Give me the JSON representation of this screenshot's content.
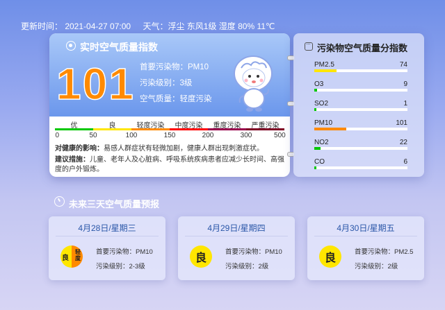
{
  "topbar": {
    "update": "更新时间：  2021-04-27 07:00",
    "weather": "天气：浮尘 东风1级 湿度 80% 11℃"
  },
  "aqi": {
    "title": "实时空气质量指数",
    "value": "101",
    "primary": "首要污染物：PM10",
    "level": "污染级别：3级",
    "quality": "空气质量：轻度污染",
    "scale_labels": [
      "优",
      "良",
      "轻度污染",
      "中度污染",
      "重度污染",
      "严重污染"
    ],
    "scale_nums": [
      "0",
      "50",
      "100",
      "150",
      "200",
      "300",
      "500"
    ],
    "scale_colors": [
      "#00c800",
      "#ffe600",
      "#ff8a00",
      "#ff0000",
      "#99004c",
      "#7e0023"
    ],
    "health_label": "对健康的影响：",
    "health_text": "易感人群症状有轻微加剧，健康人群出现刺激症状。",
    "advice_label": "建议措施：",
    "advice_text": "儿童、老年人及心脏病、呼吸系统疾病患者应减少长时间、高强度的户外锻炼。"
  },
  "pollutants": {
    "title": "污染物空气质量分指数",
    "items": [
      {
        "name": "PM2.5",
        "value": "74",
        "fill": 0.24,
        "color": "#ffe600"
      },
      {
        "name": "O3",
        "value": "9",
        "fill": 0.03,
        "color": "#00c800"
      },
      {
        "name": "SO2",
        "value": "1",
        "fill": 0.01,
        "color": "#00c800"
      },
      {
        "name": "PM10",
        "value": "101",
        "fill": 0.34,
        "color": "#ff8a00"
      },
      {
        "name": "NO2",
        "value": "22",
        "fill": 0.07,
        "color": "#00c800"
      },
      {
        "name": "CO",
        "value": "6",
        "fill": 0.02,
        "color": "#00c800"
      }
    ]
  },
  "forecast": {
    "title": "未来三天空气质量预报",
    "days": [
      {
        "date": "4月28日/星期三",
        "badge_l": "良",
        "badge_r": "轻度",
        "primary": "首要污染物：PM10",
        "level": "污染级别：2-3级"
      },
      {
        "date": "4月29日/星期四",
        "badge": "良",
        "primary": "首要污染物：PM10",
        "level": "污染级别：2级"
      },
      {
        "date": "4月30日/星期五",
        "badge": "良",
        "primary": "首要污染物：PM2.5",
        "level": "污染级别：2级"
      }
    ]
  }
}
